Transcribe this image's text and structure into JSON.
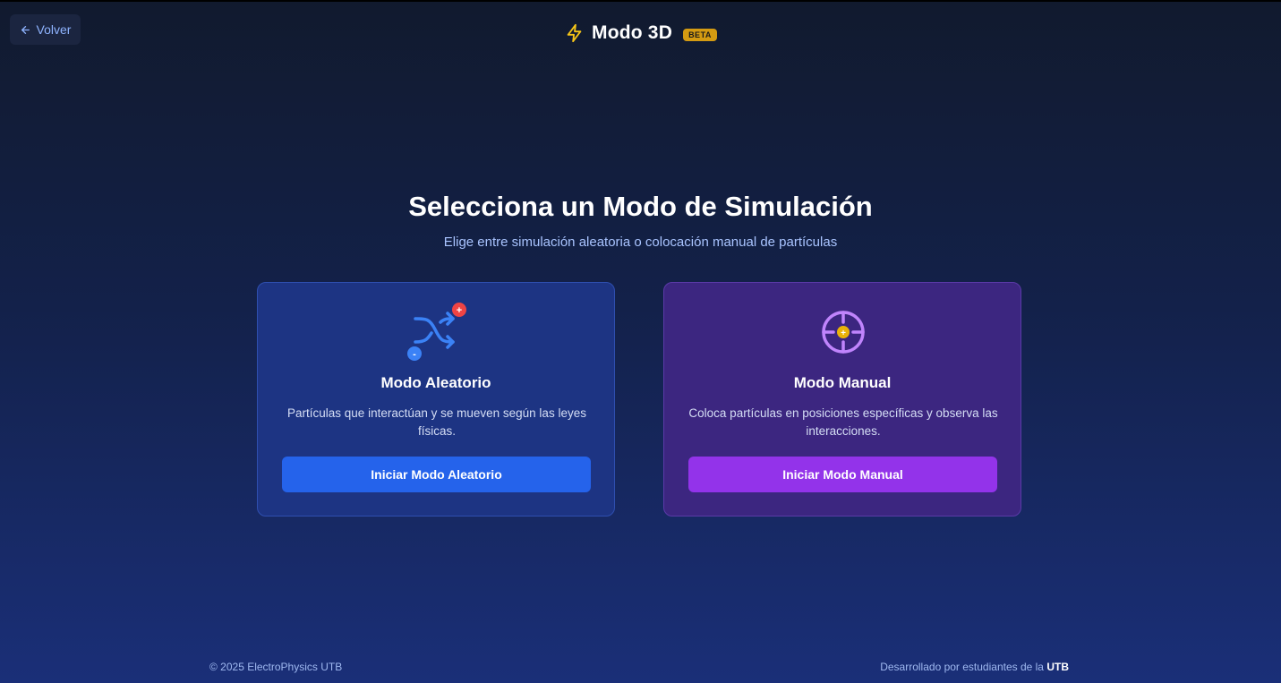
{
  "header": {
    "back_label": "Volver",
    "title": "Modo 3D",
    "badge": "BETA"
  },
  "main": {
    "heading": "Selecciona un Modo de Simulación",
    "subheading": "Elige entre simulación aleatoria o colocación manual de partículas"
  },
  "cards": [
    {
      "icon": "shuffle-icon",
      "title": "Modo Aleatorio",
      "description": "Partículas que interactúan y se mueven según las leyes físicas.",
      "button": "Iniciar Modo Aleatorio",
      "accent": "#2563eb",
      "plus_badge": "+",
      "minus_badge": "-"
    },
    {
      "icon": "crosshair-icon",
      "title": "Modo Manual",
      "description": "Coloca partículas en posiciones específicas y observa las interacciones.",
      "button": "Iniciar Modo Manual",
      "accent": "#9333ea",
      "center_badge": "+"
    }
  ],
  "footer": {
    "copyright": "© 2025 ElectroPhysics UTB",
    "credit_prefix": "Desarrollado por estudiantes de la",
    "credit_strong": "UTB"
  },
  "colors": {
    "lightning": "#f5c518",
    "badge": "#d49b12",
    "plus_badge": "#ef4444",
    "minus_badge": "#3b82f6",
    "target_ring": "#c084fc",
    "target_center": "#eab308"
  }
}
